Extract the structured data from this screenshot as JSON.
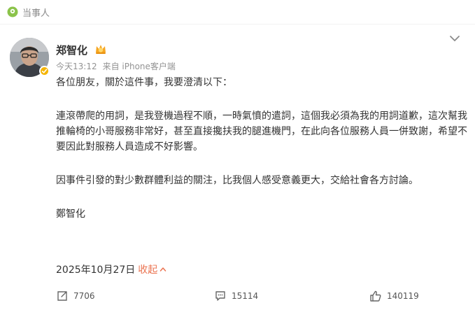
{
  "header": {
    "tag_label": "当事人",
    "tag_icon": "location-pin-icon"
  },
  "post": {
    "author": "郑智化",
    "timestamp": "今天13:12",
    "source": "来自 iPhone客户端",
    "paragraphs": [
      "各位朋友，關於這件事，我要澄清以下：",
      "連滾帶爬的用詞，是我登機過程不順，一時氣憤的遣詞，這個我必須為我的用詞道歉，這次幫我推輪椅的小哥服務非常好，甚至直接攙扶我的腿進機門，在此向各位服務人員一併致謝，希望不要因此對服務人員造成不好影響。",
      "因事件引發的對少數群體利益的關注，比我個人感受意義更大，交給社會各方討論。",
      "鄭智化"
    ],
    "date": "2025年10月27日",
    "collapse_label": "收起"
  },
  "actions": {
    "repost_count": "7706",
    "comment_count": "15114",
    "like_count": "140119"
  },
  "colors": {
    "accent": "#eb7350",
    "muted": "#939393",
    "text": "#333333"
  }
}
